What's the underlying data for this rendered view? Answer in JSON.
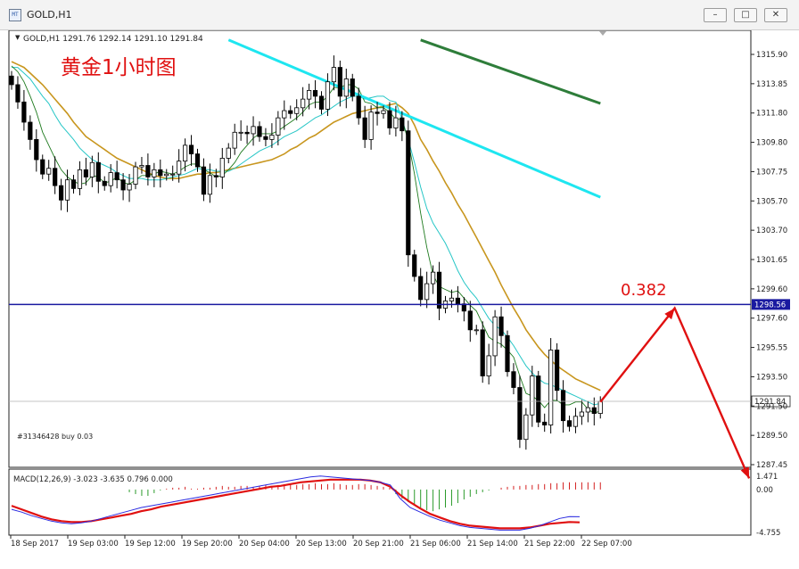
{
  "window": {
    "title": "GOLD,H1",
    "icon_name": "chart-window-icon",
    "buttons": {
      "minimize": "minimize-icon",
      "restore": "restore-icon",
      "close": "close-icon"
    }
  },
  "chart": {
    "info_line": "GOLD,H1  1291.76 1292.14 1291.10 1291.84",
    "annotation_title": "黄金1小时图",
    "order_label": "#31346428 buy 0.03",
    "fib_label": "0.382",
    "hline_price_label": "1298.56",
    "current_price_label": "1291.84",
    "price_axis_labels": [
      "1315.90",
      "1313.85",
      "1311.80",
      "1309.80",
      "1307.75",
      "1305.70",
      "1303.70",
      "1301.65",
      "1299.60",
      "1297.60",
      "1295.55",
      "1293.50",
      "1291.50",
      "1289.50",
      "1287.45"
    ],
    "macd_label": "MACD(12,26,9) -3.023 -3.635 0.796 0.000",
    "macd_axis_labels": [
      "1.471",
      "0.00",
      "-4.755"
    ],
    "time_labels": [
      "18 Sep 2017",
      "19 Sep 03:00",
      "19 Sep 12:00",
      "19 Sep 20:00",
      "20 Sep 04:00",
      "20 Sep 13:00",
      "20 Sep 21:00",
      "21 Sep 06:00",
      "21 Sep 14:00",
      "21 Sep 22:00",
      "22 Sep 07:00"
    ],
    "colors": {
      "bull_body": "#ffffff",
      "bear_body": "#000000",
      "ma_fast": "#1e7a1e",
      "ma_cyan_thin": "#26c6c6",
      "ma_gold": "#c8961e",
      "ma_cyan_thick": "#1ee6f0",
      "ma_green_thick": "#2e7d3a",
      "hline": "#1a1aa0",
      "arrow": "#e01010",
      "annotation": "#e01010",
      "macd_hist_pos": "#d42020",
      "macd_hist_neg": "#2a9a2a",
      "macd_line": "#2a2ae0",
      "signal_line": "#e01010"
    }
  },
  "chart_data": {
    "type": "candlestick",
    "symbol": "GOLD",
    "timeframe": "H1",
    "ohlc_last": {
      "open": 1291.76,
      "high": 1292.14,
      "low": 1291.1,
      "close": 1291.84
    },
    "ylim": [
      1287.45,
      1315.9
    ],
    "hline": 1298.56,
    "current_price": 1291.84,
    "fib_level": "0.382",
    "closes": [
      1313.8,
      1312.6,
      1311.2,
      1310.0,
      1308.6,
      1307.6,
      1308.0,
      1306.8,
      1305.8,
      1307.2,
      1306.6,
      1307.9,
      1307.4,
      1308.4,
      1307.1,
      1306.8,
      1307.7,
      1307.2,
      1306.5,
      1306.9,
      1308.1,
      1308.2,
      1307.4,
      1307.9,
      1307.5,
      1307.6,
      1307.6,
      1308.5,
      1309.6,
      1309.0,
      1308.1,
      1306.2,
      1307.5,
      1307.4,
      1308.7,
      1309.4,
      1310.5,
      1310.5,
      1310.4,
      1310.9,
      1310.2,
      1310.0,
      1310.3,
      1311.5,
      1312.0,
      1311.8,
      1312.2,
      1312.8,
      1313.4,
      1313.0,
      1312.1,
      1314.0,
      1315.0,
      1313.0,
      1314.2,
      1313.0,
      1311.5,
      1310.0,
      1311.9,
      1311.8,
      1312.0,
      1310.8,
      1311.5,
      1310.6,
      1302.0,
      1300.5,
      1298.9,
      1300.0,
      1300.8,
      1298.3,
      1298.8,
      1299.0,
      1298.6,
      1298.1,
      1296.8,
      1296.8,
      1293.6,
      1295.0,
      1297.7,
      1296.4,
      1293.9,
      1292.8,
      1289.2,
      1290.9,
      1293.6,
      1290.4,
      1290.2,
      1295.4,
      1292.6,
      1290.5,
      1290.1,
      1290.8,
      1291.1,
      1291.4,
      1291.0,
      1291.84
    ],
    "ma_fast": [
      1315.1,
      1314.7,
      1314.0,
      1313.0,
      1311.9,
      1310.5,
      1309.6,
      1308.7,
      1307.9,
      1307.4,
      1307.1,
      1306.9,
      1307.0,
      1307.5,
      1307.4,
      1307.0,
      1307.1,
      1307.4,
      1307.0,
      1306.9,
      1307.2,
      1307.5,
      1307.5,
      1307.6,
      1307.8,
      1307.7,
      1307.6,
      1307.8,
      1308.1,
      1308.3,
      1308.3,
      1307.9,
      1307.7,
      1307.4,
      1307.5,
      1307.9,
      1308.4,
      1309.1,
      1309.6,
      1310.1,
      1310.4,
      1310.4,
      1310.4,
      1310.6,
      1310.9,
      1311.2,
      1311.5,
      1311.9,
      1312.4,
      1312.6,
      1312.6,
      1313.0,
      1313.6,
      1313.6,
      1313.8,
      1313.8,
      1313.5,
      1312.6,
      1312.5,
      1312.2,
      1312.2,
      1311.9,
      1311.4,
      1311.4,
      1309.9,
      1307.6,
      1304.9,
      1302.5,
      1300.6,
      1299.8,
      1299.6,
      1299.4,
      1299.5,
      1299.0,
      1298.5,
      1298.1,
      1297.2,
      1296.3,
      1296.0,
      1295.8,
      1295.4,
      1294.9,
      1293.6,
      1292.4,
      1292.2,
      1291.9,
      1291.4,
      1291.9,
      1291.9,
      1291.6,
      1291.6,
      1291.8,
      1291.8,
      1291.3,
      1291.0,
      1291.2
    ],
    "ma_cyan": [
      1315.0,
      1315.0,
      1314.6,
      1314.2,
      1313.6,
      1313.0,
      1312.5,
      1311.7,
      1311.0,
      1310.5,
      1310.0,
      1309.4,
      1309.0,
      1308.6,
      1308.4,
      1308.2,
      1308.0,
      1307.7,
      1307.5,
      1307.3,
      1307.3,
      1307.3,
      1307.2,
      1307.2,
      1307.2,
      1307.3,
      1307.4,
      1307.5,
      1307.6,
      1307.8,
      1308.0,
      1307.9,
      1307.9,
      1307.8,
      1307.8,
      1307.8,
      1308.0,
      1308.3,
      1308.6,
      1308.9,
      1309.2,
      1309.4,
      1309.6,
      1309.9,
      1310.2,
      1310.4,
      1310.6,
      1310.9,
      1311.2,
      1311.5,
      1311.7,
      1312.0,
      1312.3,
      1312.6,
      1312.8,
      1313.0,
      1313.0,
      1312.8,
      1312.9,
      1313.0,
      1313.0,
      1312.7,
      1312.6,
      1311.4,
      1310.0,
      1308.4,
      1306.7,
      1305.2,
      1304.2,
      1303.5,
      1302.8,
      1301.9,
      1300.9,
      1300.1,
      1299.5,
      1299.0,
      1298.3,
      1297.6,
      1297.1,
      1296.8,
      1296.3,
      1295.7,
      1295.0,
      1294.3,
      1293.8,
      1293.4,
      1293.1,
      1293.0,
      1292.8,
      1292.6,
      1292.4,
      1292.2,
      1292.0,
      1291.8,
      1291.6,
      1291.7
    ],
    "ma_gold": [
      1315.4,
      1315.2,
      1315.0,
      1314.6,
      1314.2,
      1313.8,
      1313.3,
      1312.8,
      1312.3,
      1311.8,
      1311.2,
      1310.7,
      1310.2,
      1309.9,
      1309.6,
      1309.3,
      1309.0,
      1308.7,
      1308.5,
      1308.3,
      1308.1,
      1307.9,
      1307.7,
      1307.5,
      1307.4,
      1307.3,
      1307.3,
      1307.3,
      1307.4,
      1307.5,
      1307.6,
      1307.6,
      1307.7,
      1307.7,
      1307.8,
      1307.9,
      1308.0,
      1308.1,
      1308.2,
      1308.3,
      1308.4,
      1308.5,
      1308.6,
      1308.8,
      1309.0,
      1309.3,
      1309.5,
      1309.8,
      1310.1,
      1310.3,
      1310.6,
      1310.9,
      1311.2,
      1311.4,
      1311.6,
      1311.8,
      1311.9,
      1312.0,
      1312.1,
      1312.2,
      1312.3,
      1312.4,
      1312.5,
      1312.2,
      1311.8,
      1311.0,
      1310.0,
      1309.3,
      1308.5,
      1307.8,
      1307.0,
      1306.3,
      1305.5,
      1304.8,
      1304.0,
      1303.2,
      1302.4,
      1301.6,
      1300.8,
      1299.9,
      1299.1,
      1298.3,
      1297.6,
      1296.8,
      1296.2,
      1295.6,
      1295.1,
      1294.7,
      1294.3,
      1294.0,
      1293.7,
      1293.4,
      1293.2,
      1293.0,
      1292.8,
      1292.6
    ],
    "ma_cyan_thick": {
      "x": [
        35,
        95
      ],
      "y": [
        1316.9,
        1306.0
      ]
    },
    "ma_green_thick": {
      "x": [
        66,
        95
      ],
      "y": [
        1316.9,
        1312.5
      ]
    },
    "projection": {
      "x": [
        95,
        107,
        119
      ],
      "y": [
        1291.8,
        1298.3,
        1286.5
      ]
    },
    "macd": {
      "ylim": [
        -4.755,
        1.471
      ],
      "hist_x_start": 19,
      "hist": [
        -0.3,
        -0.5,
        -0.7,
        -0.7,
        -0.4,
        -0.1,
        0.1,
        0.2,
        0.2,
        0.3,
        0.1,
        0.1,
        0.2,
        0.2,
        0.3,
        0.4,
        0.3,
        0.3,
        0.4,
        0.4,
        0.3,
        0.4,
        0.5,
        0.4,
        0.5,
        0.6,
        0.6,
        0.5,
        0.6,
        0.6,
        0.7,
        0.6,
        0.6,
        0.7,
        0.6,
        0.5,
        0.5,
        0.6,
        0.6,
        0.5,
        0.4,
        0.3,
        0.2,
        -0.5,
        -1.0,
        -1.4,
        -1.7,
        -2.0,
        -2.3,
        -2.4,
        -2.2,
        -2.0,
        -1.8,
        -1.5,
        -1.1,
        -0.8,
        -0.5,
        -0.3,
        -0.1,
        0.0,
        0.2,
        0.3,
        0.4,
        0.4,
        0.5,
        0.5,
        0.6,
        0.6,
        0.7,
        0.7,
        0.8,
        0.8,
        0.8,
        0.8,
        0.8,
        0.8,
        0.8
      ],
      "macd_line": [
        -2.2,
        -2.5,
        -2.9,
        -3.2,
        -3.5,
        -3.7,
        -3.8,
        -3.7,
        -3.5,
        -3.2,
        -2.9,
        -2.6,
        -2.3,
        -2.0,
        -1.8,
        -1.6,
        -1.4,
        -1.2,
        -1.0,
        -0.8,
        -0.6,
        -0.4,
        -0.2,
        0.0,
        0.2,
        0.4,
        0.6,
        0.8,
        1.0,
        1.2,
        1.4,
        1.5,
        1.4,
        1.3,
        1.2,
        1.1,
        1.0,
        0.8,
        0.5,
        -1.0,
        -2.0,
        -2.5,
        -3.0,
        -3.4,
        -3.7,
        -4.0,
        -4.2,
        -4.3,
        -4.4,
        -4.5,
        -4.5,
        -4.5,
        -4.3,
        -4.0,
        -3.6,
        -3.2,
        -3.0,
        -3.02
      ],
      "signal_line": [
        -1.8,
        -2.2,
        -2.6,
        -3.0,
        -3.3,
        -3.5,
        -3.6,
        -3.6,
        -3.5,
        -3.3,
        -3.1,
        -2.9,
        -2.7,
        -2.4,
        -2.2,
        -1.9,
        -1.7,
        -1.5,
        -1.3,
        -1.1,
        -0.9,
        -0.7,
        -0.5,
        -0.3,
        -0.1,
        0.1,
        0.3,
        0.4,
        0.6,
        0.8,
        0.9,
        1.0,
        1.1,
        1.1,
        1.1,
        1.1,
        1.0,
        0.8,
        0.3,
        -0.6,
        -1.4,
        -2.1,
        -2.7,
        -3.1,
        -3.5,
        -3.8,
        -4.0,
        -4.1,
        -4.2,
        -4.3,
        -4.3,
        -4.3,
        -4.2,
        -4.0,
        -3.8,
        -3.7,
        -3.6,
        -3.635
      ]
    }
  }
}
